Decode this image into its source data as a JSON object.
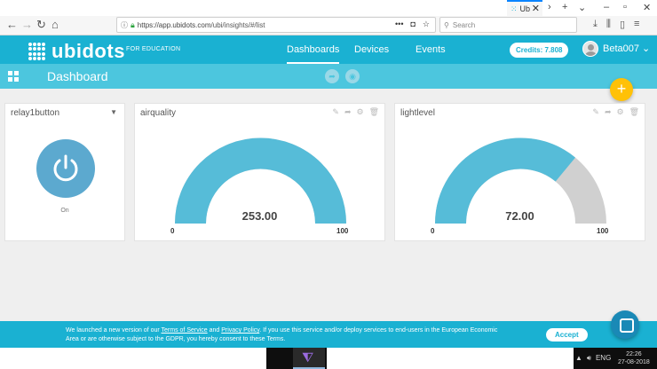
{
  "browser": {
    "tab_title": "Ub",
    "url_host": "https://app.ubidots.com",
    "url_path": "/ubi/insights/#/list",
    "search_placeholder": "Search",
    "url_menu": "•••"
  },
  "header": {
    "logo_text": "ubidots",
    "logo_sub": "FOR EDUCATION",
    "nav": [
      {
        "label": "Dashboards",
        "active": true
      },
      {
        "label": "Devices",
        "active": false
      },
      {
        "label": "Events",
        "active": false
      }
    ],
    "credits": "Credits: 7.808",
    "username": "Beta007",
    "user_caret": "⌄"
  },
  "subheader": {
    "title": "Dashboard"
  },
  "fab_label": "+",
  "widgets": {
    "switch": {
      "title": "relay1button",
      "state_label": "On"
    },
    "air": {
      "title": "airquality",
      "value": "253.00",
      "min": "0",
      "max": "100",
      "fill_fraction": 1.0,
      "color": "#56bcd8",
      "track": "#d0d0d0"
    },
    "light": {
      "title": "lightlevel",
      "value": "72.00",
      "min": "0",
      "max": "100",
      "fill_fraction": 0.72,
      "color": "#56bcd8",
      "track": "#d0d0d0"
    }
  },
  "cookie": {
    "text_1": "We launched a new version of our ",
    "tos": "Terms of Service",
    "and": " and ",
    "privacy": "Privacy Policy",
    "text_2": ". If you use this service and/or deploy services to end-users in the European Economic Area or are otherwise subject to the GDPR, you hereby consent to these Terms.",
    "accept": "Accept"
  },
  "taskbar": {
    "lang": "ENG",
    "time": "22:26",
    "date": "27-08-2018"
  },
  "colors": {
    "brand": "#1ab1d2",
    "brand_light": "#4cc6de",
    "fab": "#ffc107"
  }
}
